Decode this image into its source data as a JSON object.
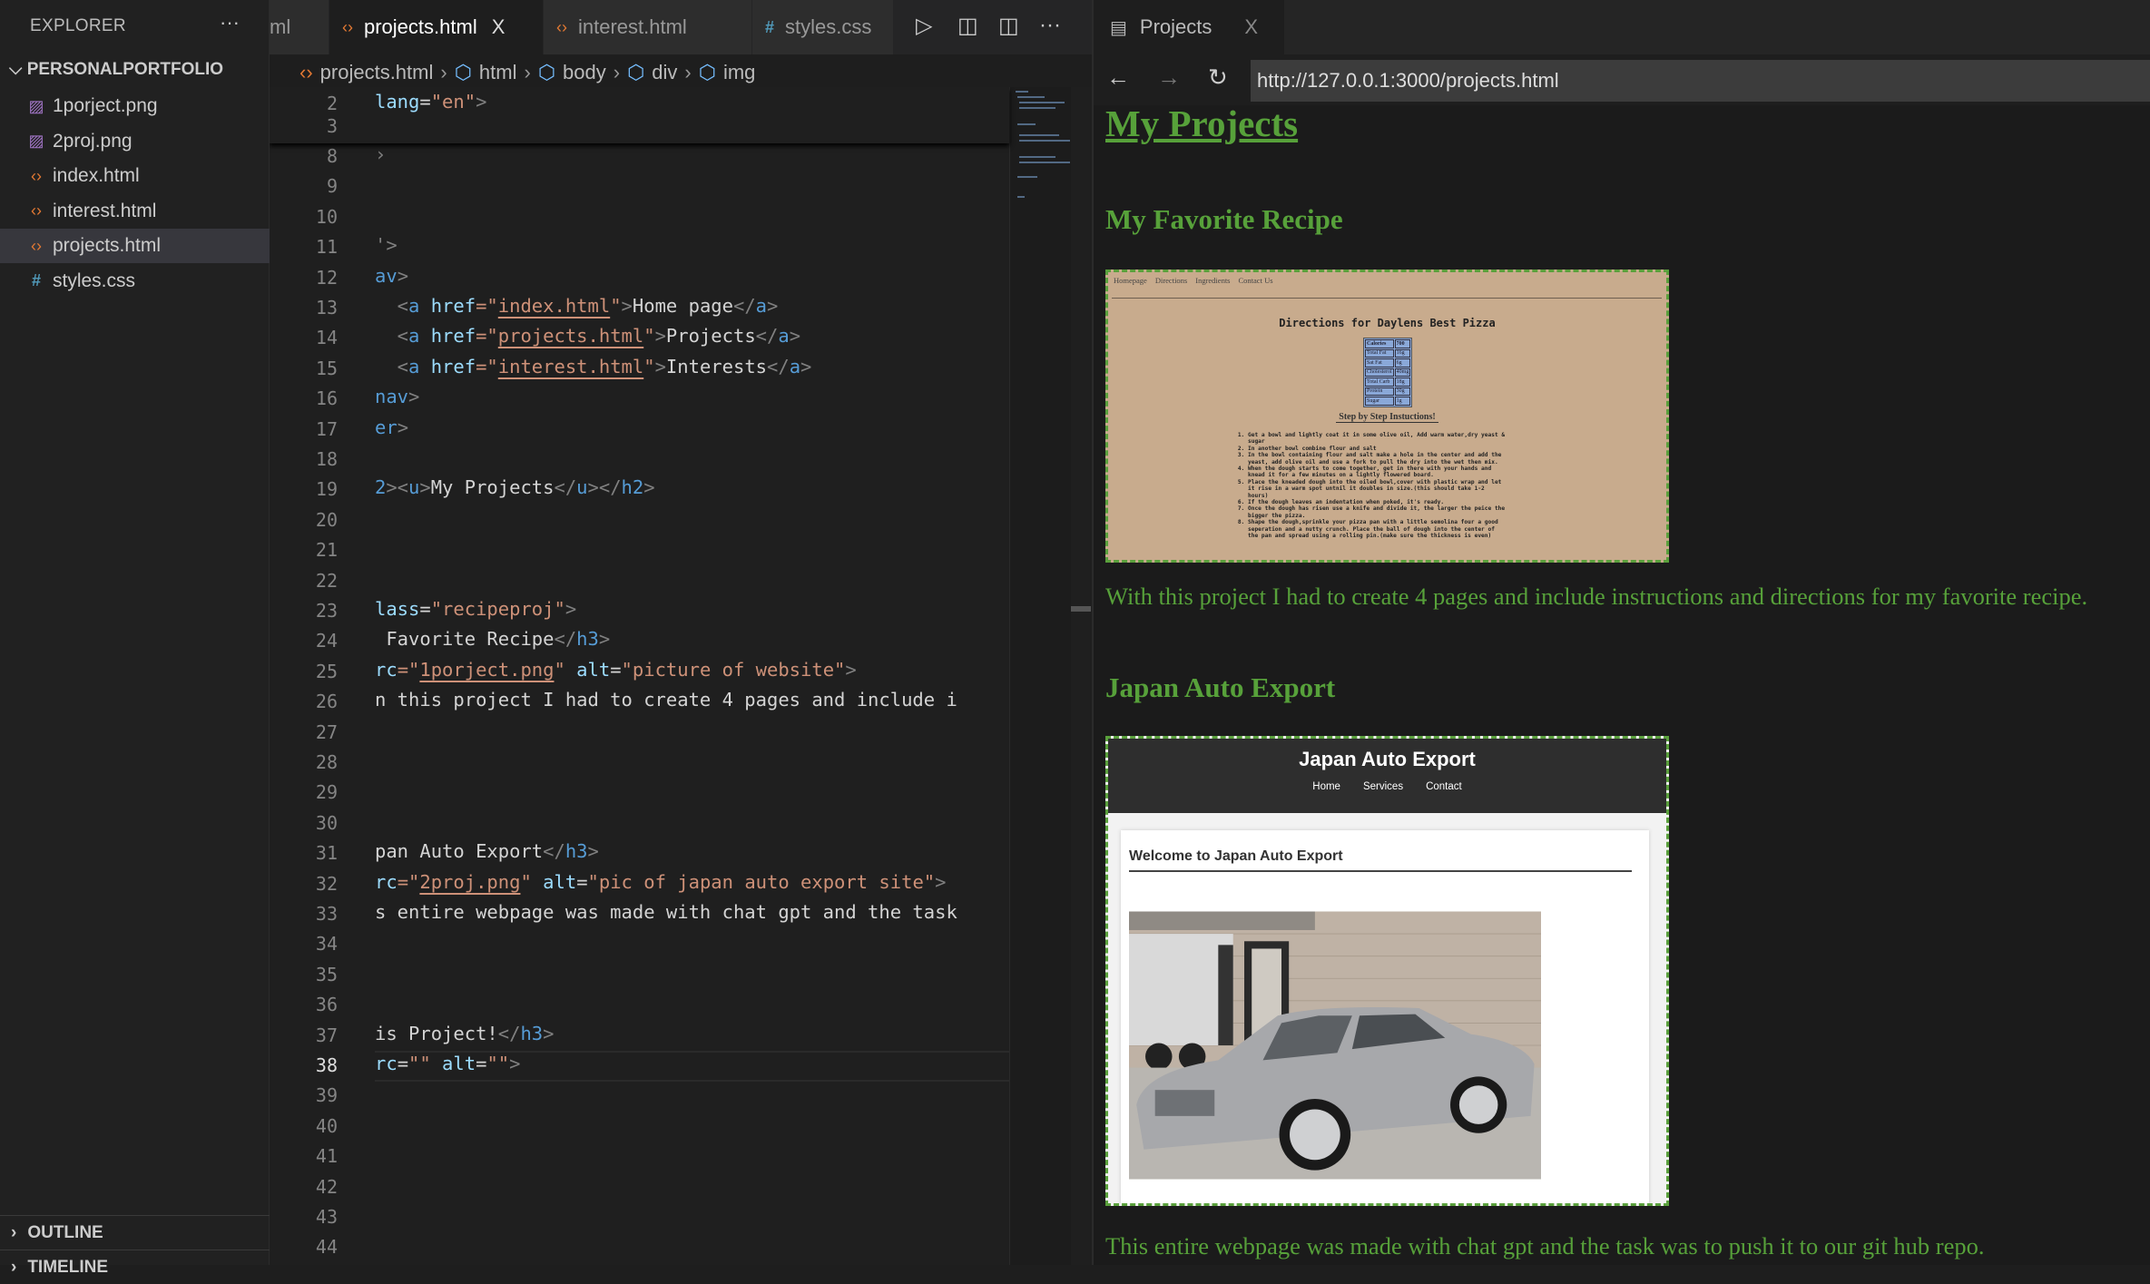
{
  "sidebar": {
    "title": "EXPLORER",
    "more": "···",
    "folder": "PERSONALPORTFOLIO",
    "files": [
      {
        "name": "1porject.png",
        "type": "img"
      },
      {
        "name": "2proj.png",
        "type": "img"
      },
      {
        "name": "index.html",
        "type": "html"
      },
      {
        "name": "interest.html",
        "type": "html"
      },
      {
        "name": "projects.html",
        "type": "html",
        "selected": true
      },
      {
        "name": "styles.css",
        "type": "css"
      }
    ],
    "outline": "OUTLINE",
    "timeline": "TIMELINE"
  },
  "editor_tabs": [
    {
      "label": "ml",
      "icon": ""
    },
    {
      "label": "projects.html",
      "icon": "‹›",
      "active": true,
      "close": "X"
    },
    {
      "label": "interest.html",
      "icon": "‹›"
    },
    {
      "label": "styles.css",
      "icon": "#"
    }
  ],
  "breadcrumb": [
    "projects.html",
    "html",
    "body",
    "div",
    "img"
  ],
  "sticky_lines": [
    {
      "n": "2",
      "tokens": [
        [
          "lang",
          "attr"
        ],
        [
          "=",
          "txt"
        ],
        [
          "\"en\"",
          "str"
        ],
        [
          ">",
          "pun"
        ]
      ]
    },
    {
      "n": "3",
      "tokens": []
    }
  ],
  "code_lines": [
    {
      "n": "8",
      "tokens": [
        [
          "›",
          "pun"
        ]
      ]
    },
    {
      "n": "9",
      "tokens": []
    },
    {
      "n": "10",
      "tokens": []
    },
    {
      "n": "11",
      "tokens": [
        [
          "'>",
          "pun"
        ]
      ]
    },
    {
      "n": "12",
      "tokens": [
        [
          "av",
          "tag"
        ],
        [
          ">",
          "pun"
        ]
      ]
    },
    {
      "n": "13",
      "tokens": [
        [
          "  <",
          "pun"
        ],
        [
          "a",
          "tag"
        ],
        [
          " href",
          "attr"
        ],
        [
          "=\"",
          "str"
        ],
        [
          "index.html",
          "link"
        ],
        [
          "\"",
          "str"
        ],
        [
          ">",
          "pun"
        ],
        [
          "Home page",
          "txt"
        ],
        [
          "</",
          "pun"
        ],
        [
          "a",
          "tag"
        ],
        [
          ">",
          "pun"
        ]
      ]
    },
    {
      "n": "14",
      "tokens": [
        [
          "  <",
          "pun"
        ],
        [
          "a",
          "tag"
        ],
        [
          " href",
          "attr"
        ],
        [
          "=\"",
          "str"
        ],
        [
          "projects.html",
          "link"
        ],
        [
          "\"",
          "str"
        ],
        [
          ">",
          "pun"
        ],
        [
          "Projects",
          "txt"
        ],
        [
          "</",
          "pun"
        ],
        [
          "a",
          "tag"
        ],
        [
          ">",
          "pun"
        ]
      ]
    },
    {
      "n": "15",
      "tokens": [
        [
          "  <",
          "pun"
        ],
        [
          "a",
          "tag"
        ],
        [
          " href",
          "attr"
        ],
        [
          "=\"",
          "str"
        ],
        [
          "interest.html",
          "link"
        ],
        [
          "\"",
          "str"
        ],
        [
          ">",
          "pun"
        ],
        [
          "Interests",
          "txt"
        ],
        [
          "</",
          "pun"
        ],
        [
          "a",
          "tag"
        ],
        [
          ">",
          "pun"
        ]
      ]
    },
    {
      "n": "16",
      "tokens": [
        [
          "nav",
          "tag"
        ],
        [
          ">",
          "pun"
        ]
      ]
    },
    {
      "n": "17",
      "tokens": [
        [
          "er",
          "tag"
        ],
        [
          ">",
          "pun"
        ]
      ]
    },
    {
      "n": "18",
      "tokens": []
    },
    {
      "n": "19",
      "tokens": [
        [
          "2",
          "tag"
        ],
        [
          "><",
          "pun"
        ],
        [
          "u",
          "tag"
        ],
        [
          ">",
          "pun"
        ],
        [
          "My Projects",
          "txt"
        ],
        [
          "</",
          "pun"
        ],
        [
          "u",
          "tag"
        ],
        [
          "></",
          "pun"
        ],
        [
          "h2",
          "tag"
        ],
        [
          ">",
          "pun"
        ]
      ]
    },
    {
      "n": "20",
      "tokens": []
    },
    {
      "n": "21",
      "tokens": []
    },
    {
      "n": "22",
      "tokens": []
    },
    {
      "n": "23",
      "tokens": [
        [
          "lass",
          "attr"
        ],
        [
          "=",
          "txt"
        ],
        [
          "\"recipeproj\"",
          "str"
        ],
        [
          ">",
          "pun"
        ]
      ]
    },
    {
      "n": "24",
      "tokens": [
        [
          " Favorite Recipe",
          "txt"
        ],
        [
          "</",
          "pun"
        ],
        [
          "h3",
          "tag"
        ],
        [
          ">",
          "pun"
        ]
      ]
    },
    {
      "n": "25",
      "tokens": [
        [
          "rc",
          "attr"
        ],
        [
          "=\"",
          "str"
        ],
        [
          "1porject.png",
          "link"
        ],
        [
          "\"",
          "str"
        ],
        [
          " alt",
          "attr"
        ],
        [
          "=",
          "txt"
        ],
        [
          "\"picture of website\"",
          "str"
        ],
        [
          ">",
          "pun"
        ]
      ]
    },
    {
      "n": "26",
      "tokens": [
        [
          "n this project I had to create 4 pages and include i",
          "txt"
        ]
      ]
    },
    {
      "n": "27",
      "tokens": []
    },
    {
      "n": "28",
      "tokens": []
    },
    {
      "n": "29",
      "tokens": []
    },
    {
      "n": "30",
      "tokens": []
    },
    {
      "n": "31",
      "tokens": [
        [
          "pan Auto Export",
          "txt"
        ],
        [
          "</",
          "pun"
        ],
        [
          "h3",
          "tag"
        ],
        [
          ">",
          "pun"
        ]
      ]
    },
    {
      "n": "32",
      "tokens": [
        [
          "rc",
          "attr"
        ],
        [
          "=\"",
          "str"
        ],
        [
          "2proj.png",
          "link"
        ],
        [
          "\"",
          "str"
        ],
        [
          " alt",
          "attr"
        ],
        [
          "=",
          "txt"
        ],
        [
          "\"pic of japan auto export site\"",
          "str"
        ],
        [
          ">",
          "pun"
        ]
      ]
    },
    {
      "n": "33",
      "tokens": [
        [
          "s entire webpage was made with chat gpt and the task",
          "txt"
        ]
      ]
    },
    {
      "n": "34",
      "tokens": []
    },
    {
      "n": "35",
      "tokens": []
    },
    {
      "n": "36",
      "tokens": []
    },
    {
      "n": "37",
      "tokens": [
        [
          "is Project!",
          "txt"
        ],
        [
          "</",
          "pun"
        ],
        [
          "h3",
          "tag"
        ],
        [
          ">",
          "pun"
        ]
      ]
    },
    {
      "n": "38",
      "current": true,
      "tokens": [
        [
          "rc",
          "attr"
        ],
        [
          "=",
          "txt"
        ],
        [
          "\"\"",
          "str"
        ],
        [
          " alt",
          "attr"
        ],
        [
          "=",
          "txt"
        ],
        [
          "\"\"",
          "str"
        ],
        [
          ">",
          "pun"
        ]
      ]
    },
    {
      "n": "39",
      "tokens": []
    },
    {
      "n": "40",
      "tokens": []
    },
    {
      "n": "41",
      "tokens": []
    },
    {
      "n": "42",
      "tokens": []
    },
    {
      "n": "43",
      "tokens": []
    },
    {
      "n": "44",
      "tokens": []
    }
  ],
  "browser": {
    "tab_label": "Projects",
    "tab_close": "X",
    "url": "http://127.0.0.1:3000/projects.html",
    "back": "←",
    "forward": "→",
    "reload": "↻"
  },
  "page": {
    "heading": "My Projects",
    "projects": [
      {
        "title": "My Favorite Recipe",
        "description": "With this project I had to create 4 pages and include instructions and directions for my favorite recipe."
      },
      {
        "title": "Japan Auto Export",
        "description": "This entire webpage was made with chat gpt and the task was to push it to our git hub repo."
      }
    ],
    "pizza_shot": {
      "nav": [
        "Homepage",
        "Directions",
        "Ingredients",
        "Contact Us"
      ],
      "title": "Directions for Daylens Best Pizza",
      "nutrition": [
        [
          "Calories",
          "700"
        ],
        [
          "Total Fat",
          "16g"
        ],
        [
          "Sat Fat",
          "6g"
        ],
        [
          "Cholesterol",
          "40mg"
        ],
        [
          "Total Carb",
          "18g"
        ],
        [
          "Protein",
          "30g"
        ],
        [
          "Sugar",
          "1g"
        ]
      ],
      "steps_heading": "Step by Step Instuctions!",
      "steps": [
        "Get a bowl and lightly coat it in some olive oil, Add warm water,dry yeast & sugar",
        "In another bowl combine flour and salt",
        "In the bowl containing flour and salt make a hole in the center and add the yeast, add olive oil and use a fork to pull the dry into the wet then mix.",
        "When the dough starts to come together, get in there with your hands and knead it for a few minutes on a lightly flowered board.",
        "Place the kneaded dough into the oiled bowl,cover with plastic wrap and let it rise in a warm spot untnil it doubles in size.(this should take 1-2 hours)",
        "If the dough leaves an indentation when poked, it's ready.",
        "Once the dough has risen use a knife and divide it, the larger the peice the bigger the pizza.",
        "Shape the dough,sprinkle your pizza pan with a little semolina four a good seperation and a nutty crunch. Place the ball of dough into the center of the pan and spread using a rolling pin.(make sure the thickness is even)"
      ]
    },
    "jae_shot": {
      "title": "Japan Auto Export",
      "nav": [
        "Home",
        "Services",
        "Contact"
      ],
      "welcome": "Welcome to Japan Auto Export"
    }
  },
  "colors": {
    "accent_green": "#57a13a",
    "tag": "#569cd6",
    "attr": "#9cdcfe",
    "string": "#ce9178"
  }
}
